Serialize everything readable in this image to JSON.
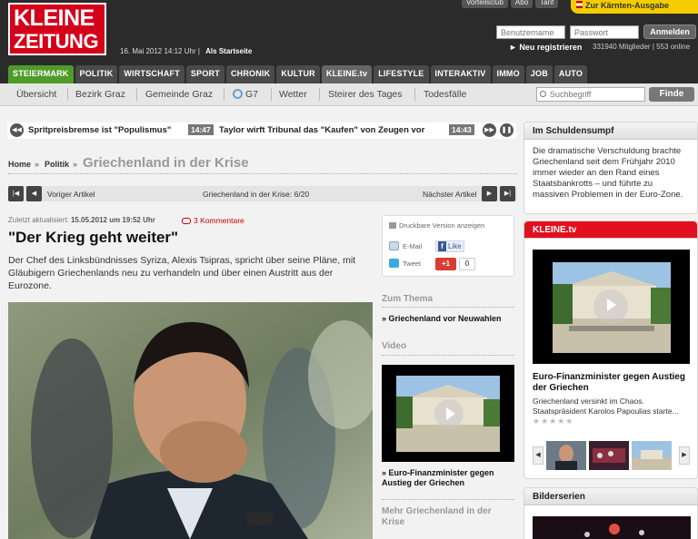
{
  "header": {
    "logo_line1": "KLEINE",
    "logo_line2": "ZEITUNG",
    "date": "16. Mai 2012 14:12 Uhr",
    "start_link": "Als Startseite",
    "top_links": [
      "Vorteilsclub",
      "Abo",
      "Tarif"
    ],
    "region_tab": "Zur Kärnten-Ausgabe",
    "login": {
      "username_placeholder": "Benutzername",
      "password_placeholder": "Passwort",
      "submit": "Anmelden",
      "register": "► Neu registrieren",
      "members": "331940 Mitglieder | 553 online"
    }
  },
  "main_nav": [
    {
      "label": "STEIERMARK",
      "active": true
    },
    {
      "label": "POLITIK"
    },
    {
      "label": "WIRTSCHAFT"
    },
    {
      "label": "SPORT"
    },
    {
      "label": "CHRONIK"
    },
    {
      "label": "KULTUR"
    },
    {
      "label": "KLEINE.tv"
    },
    {
      "label": "LIFESTYLE"
    },
    {
      "label": "INTERAKTIV"
    },
    {
      "label": "IMMO"
    },
    {
      "label": "JOB"
    },
    {
      "label": "AUTO"
    }
  ],
  "sub_nav": {
    "items": [
      "Übersicht",
      "Bezirk Graz",
      "Gemeinde Graz",
      "G7",
      "Wetter",
      "Steirer des Tages",
      "Todesfälle"
    ],
    "search_placeholder": "Suchbegriff",
    "search_button": "Finde"
  },
  "ticker": {
    "item1": "Spritpreisbremse ist \"Populismus\"",
    "time2": "14:47",
    "item2": "Taylor wirft Tribunal das \"Kaufen\" von Zeugen vor",
    "time3": "14:43"
  },
  "breadcrumb": {
    "home": "Home",
    "section": "Politik",
    "current": "Griechenland in der Krise"
  },
  "pager": {
    "prev": "Voriger Artikel",
    "position": "Griechenland in der Krise: 6/20",
    "next": "Nächster Artikel"
  },
  "article": {
    "updated_label": "Zuletzt aktualisiert:",
    "updated_value": "15.05.2012 um 19:52 Uhr",
    "comments": "3 Kommentare",
    "headline": "\"Der Krieg geht weiter\"",
    "lead": "Der Chef des Linksbündnisses Syriza, Alexis Tsipras, spricht über seine Pläne, mit Gläubigern Griechenlands neu zu verhandeln und über einen Austritt aus der Eurozone."
  },
  "tools": {
    "print": "Druckbare Version anzeigen",
    "email": "E-Mail",
    "like": "Like",
    "tweet": "Tweet",
    "gplus": "+1",
    "gplus_count": "0"
  },
  "middle": {
    "zum_thema_heading": "Zum Thema",
    "zum_thema_link": "Griechenland vor Neuwahlen",
    "video_heading": "Video",
    "video_caption": "Euro-Finanzminister gegen Austieg der Griechen",
    "mehr_heading": "Mehr Griechenland in der Krise"
  },
  "right": {
    "schulden_heading": "Im Schuldensumpf",
    "schulden_text": "Die dramatische Verschuldung brachte Griechenland seit dem Frühjahr 2010 immer wieder an den Rand eines Staatsbankrotts – und führte zu massiven Problemen in der Euro-Zone.",
    "tv_heading": "KLEINE.tv",
    "tv_title": "Euro-Finanzminister gegen Austieg der Griechen",
    "tv_desc": "Griechenland versinkt im Chaos. Staatspräsident Karolos Papoulias starte...",
    "stars": "★★★★★",
    "bilder_heading": "Bilderserien"
  },
  "colors": {
    "brand_red": "#d4001a",
    "active_nav": "#4f9b2a",
    "region_yellow": "#f4cd00"
  }
}
